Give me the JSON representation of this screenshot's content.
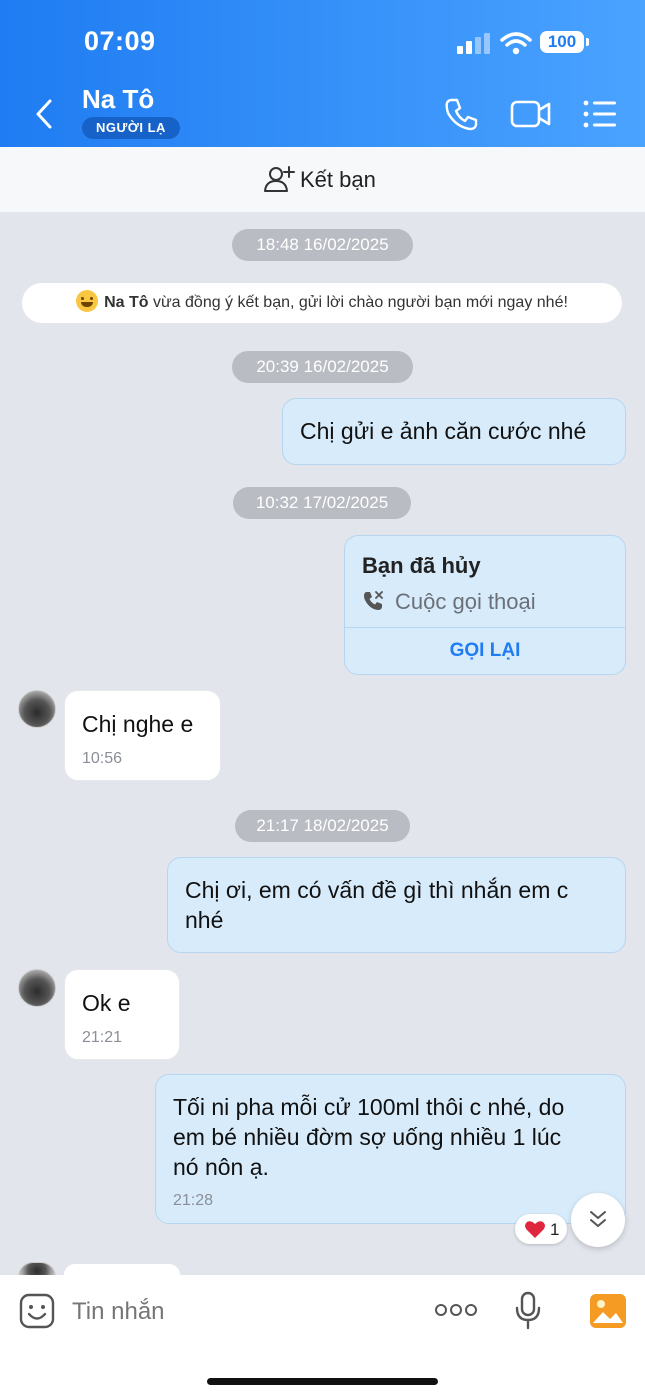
{
  "status_bar": {
    "time": "07:09",
    "battery": "100"
  },
  "header": {
    "contact_name": "Na Tô",
    "badge": "NGƯỜI LẠ"
  },
  "add_friend": {
    "label": "Kết bạn"
  },
  "messages": {
    "ts1": "18:48 16/02/2025",
    "system_name": "Na Tô",
    "system_text": " vừa đồng ý kết bạn, gửi lời chào người bạn mới ngay nhé!",
    "ts2": "20:39 16/02/2025",
    "m1": "Chị gửi e ảnh căn cước nhé",
    "ts3": "10:32 17/02/2025",
    "call_title": "Bạn đã hủy",
    "call_subtitle": "Cuộc gọi thoại",
    "call_action": "GỌI LẠI",
    "m2": "Chị nghe e",
    "m2_time": "10:56",
    "ts4": "21:17 18/02/2025",
    "m3_line1": "Chị ơi, em có vấn đề gì thì nhắn em c",
    "m3_line2": "nhé",
    "m4": "Ok e",
    "m4_time": "21:21",
    "m5_line1": "Tối ni pha mỗi cử 100ml thôi c nhé, do",
    "m5_line2": "em bé nhiều đờm sợ uống nhiều 1 lúc",
    "m5_line3": "nó nôn ạ.",
    "m5_time": "21:28",
    "reaction_count": "1"
  },
  "input": {
    "placeholder": "Tin nhắn"
  },
  "colors": {
    "header_start": "#1f7cf2",
    "header_end": "#4aa3ff",
    "outgoing_bubble": "#d7ebfb",
    "chat_background": "#e2e5ec",
    "accent": "#1f7cf2"
  },
  "icons": [
    "back-icon",
    "phone-icon",
    "video-call-icon",
    "menu-icon",
    "add-friend-icon",
    "missed-call-icon",
    "heart-icon",
    "chevron-down-icon",
    "emoji-icon",
    "more-icon",
    "microphone-icon",
    "image-icon",
    "signal-icon",
    "wifi-icon"
  ]
}
